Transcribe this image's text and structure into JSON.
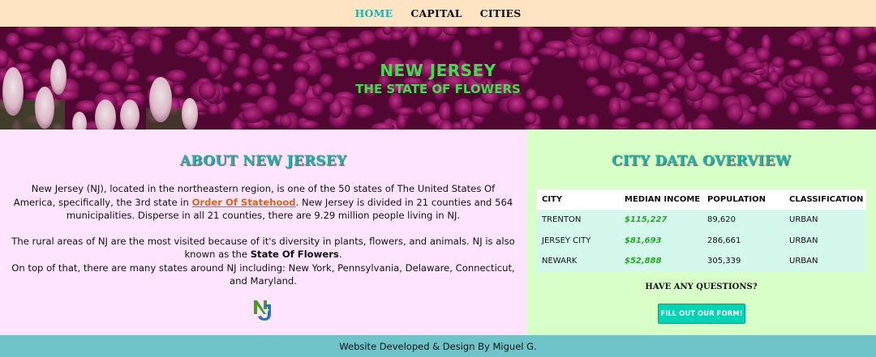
{
  "nav": {
    "items": [
      {
        "label": "HOME",
        "active": true
      },
      {
        "label": "CAPITAL",
        "active": false
      },
      {
        "label": "CITIES",
        "active": false
      }
    ]
  },
  "hero": {
    "title": "NEW JERSEY",
    "subtitle": "THE STATE OF FLOWERS"
  },
  "about": {
    "heading": "ABOUT NEW JERSEY",
    "p1_a": "New Jersey (NJ), located in the northeastern region, is one of the 50 states of The United States Of America, specifically, the 3rd state in ",
    "p1_link": "Order Of Statehood",
    "p1_b": ". New Jersey is divided in 21 counties and 564 municipalities. Disperse in all 21 counties, there are 9.29 million people living in NJ.",
    "p2_a": "The rural areas of NJ are the most visited because of it's diversity in plants, flowers, and animals. NJ is also known as the ",
    "p2_bold": "State Of Flowers",
    "p2_b": ".",
    "p2_c": "On top of that, there are many states around NJ including: New York, Pennsylvania, Delaware, Connecticut, and Maryland.",
    "logo": "NJ"
  },
  "city_data": {
    "heading": "CITY DATA OVERVIEW",
    "columns": [
      "CITY",
      "MEDIAN INCOME",
      "POPULATION",
      "CLASSIFICATION"
    ],
    "rows": [
      [
        "TRENTON",
        "$115,227",
        "89,620",
        "URBAN"
      ],
      [
        "JERSEY CITY",
        "$81,693",
        "286,661",
        "URBAN"
      ],
      [
        "NEWARK",
        "$52,888",
        "305,339",
        "URBAN"
      ]
    ],
    "questions": "HAVE ANY QUESTIONS?",
    "form_button": "FILL OUT OUR FORM!"
  },
  "footer": {
    "text": "Website Developed & Design By Miguel G."
  },
  "colors": {
    "nav_bg": "#ffe4c4",
    "nav_active": "#20b2aa",
    "hero_text": "#3ce04a",
    "about_bg": "#ffe4ff",
    "city_bg": "#d8ffc8",
    "table_row_bg": "#d4f8ec",
    "income_text": "#22aa22",
    "button_bg": "#00d4b4",
    "footer_bg": "#6ec4c8",
    "link": "#d2691e"
  }
}
